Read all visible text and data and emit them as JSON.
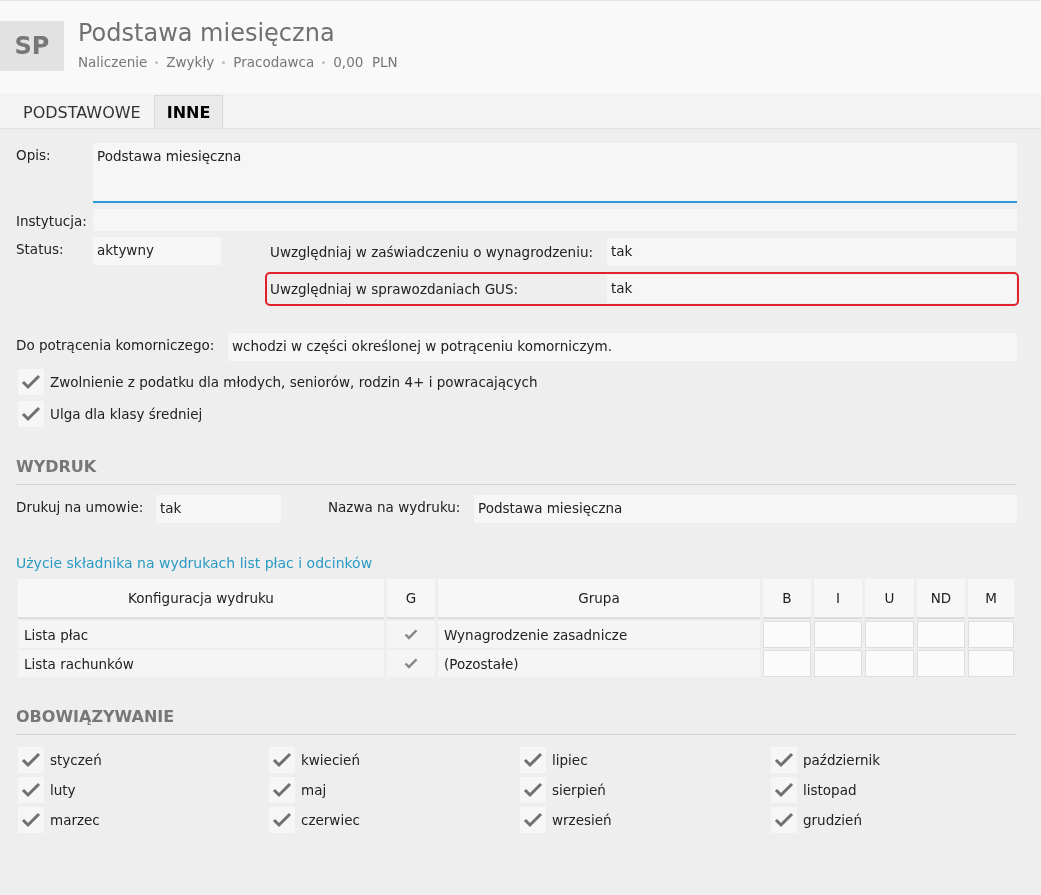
{
  "header": {
    "initials": "SP",
    "title": "Podstawa miesięczna",
    "meta": [
      "Naliczenie",
      "Zwykły",
      "Pracodawca",
      "0,00  PLN"
    ]
  },
  "tabs": [
    {
      "label": "PODSTAWOWE",
      "selected": false
    },
    {
      "label": "INNE",
      "selected": true
    }
  ],
  "opis": {
    "label": "Opis:",
    "value": "Podstawa miesięczna"
  },
  "instytucja": {
    "label": "Instytucja:"
  },
  "status": {
    "label": "Status:",
    "value": "aktywny"
  },
  "flags": [
    {
      "label": "Uwzględniaj w zaświadczeniu o wynagrodzeniu:",
      "value": "tak",
      "highlighted": false
    },
    {
      "label": "Uwzględniaj w sprawozdaniach GUS:",
      "value": "tak",
      "highlighted": true
    }
  ],
  "komornik": {
    "label": "Do potrącenia komorniczego:",
    "value": "wchodzi w części określonej w potrąceniu komorniczym."
  },
  "options": [
    {
      "label": "Zwolnienie z podatku dla młodych, seniorów, rodzin 4+ i powracających",
      "checked": true
    },
    {
      "label": "Ulga dla klasy średniej",
      "checked": true
    }
  ],
  "wydruk": {
    "heading": "WYDRUK",
    "print_label": "Drukuj na umowie:",
    "print_value": "tak",
    "name_label": "Nazwa na wydruku:",
    "name_value": "Podstawa miesięczna",
    "link": "Użycie składnika na wydrukach list płac i odcinków"
  },
  "table": {
    "columns": [
      "Konfiguracja wydruku",
      "G",
      "Grupa",
      "B",
      "I",
      "U",
      "ND",
      "M"
    ],
    "rows": [
      {
        "config": "Lista płac",
        "g": true,
        "group": "Wynagrodzenie zasadnicze"
      },
      {
        "config": "Lista rachunków",
        "g": true,
        "group": "(Pozostałe)"
      }
    ]
  },
  "obowiazywanie": {
    "heading": "OBOWIĄZYWANIE",
    "months": [
      {
        "label": "styczeń",
        "checked": true
      },
      {
        "label": "luty",
        "checked": true
      },
      {
        "label": "marzec",
        "checked": true
      },
      {
        "label": "kwiecień",
        "checked": true
      },
      {
        "label": "maj",
        "checked": true
      },
      {
        "label": "czerwiec",
        "checked": true
      },
      {
        "label": "lipiec",
        "checked": true
      },
      {
        "label": "sierpień",
        "checked": true
      },
      {
        "label": "wrzesień",
        "checked": true
      },
      {
        "label": "październik",
        "checked": true
      },
      {
        "label": "listopad",
        "checked": true
      },
      {
        "label": "grudzień",
        "checked": true
      }
    ]
  }
}
